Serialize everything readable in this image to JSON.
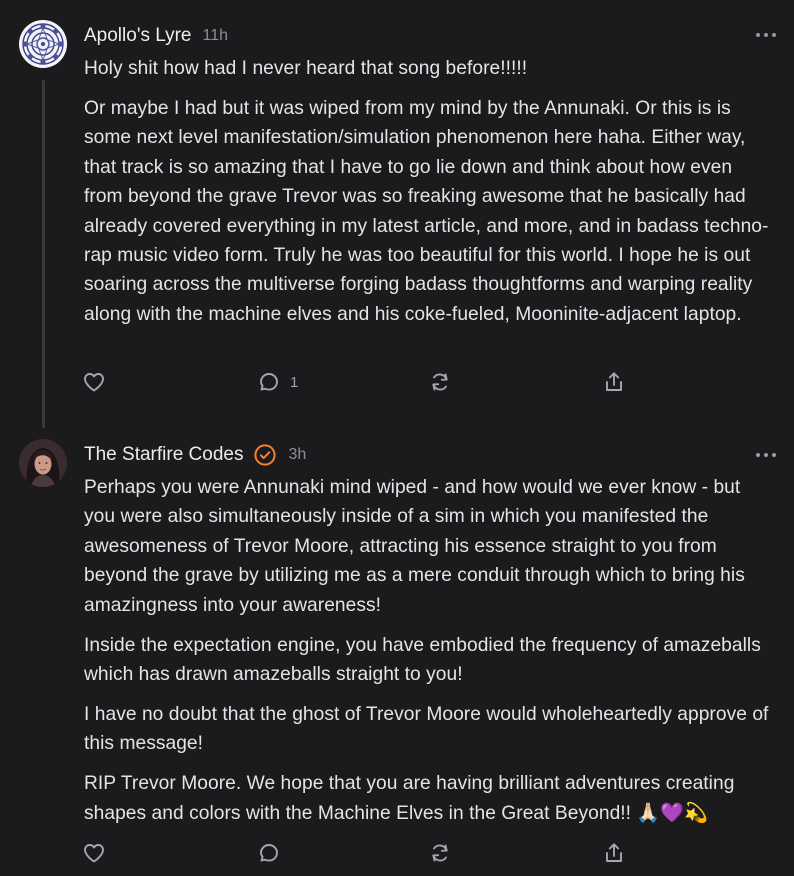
{
  "comments": [
    {
      "author": "Apollo's Lyre",
      "time": "11h",
      "avatar": "mandala-avatar",
      "paragraphs": [
        "Holy shit how had I never heard that song before!!!!!",
        "Or maybe I had but it was wiped from my mind by the Annunaki. Or this is is some next level manifestation/simulation phenomenon here haha. Either way, that track is so amazing that I have to go lie down and think about how even from beyond the grave Trevor was so freaking awesome that he basically had already covered everything in my latest article, and more, and in badass techno-rap music video form. Truly he was too beautiful for this world. I hope he is out soaring across the multiverse forging badass thoughtforms and warping reality along with the machine elves and his coke-fueled, Mooninite-adjacent laptop."
      ],
      "actions": {
        "like_icon": "heart-icon",
        "reply_icon": "comment-icon",
        "reply_count": "1",
        "restack_icon": "restack-icon",
        "share_icon": "share-icon"
      }
    },
    {
      "author": "The Starfire Codes",
      "verified_icon": "verified-check-icon",
      "time": "3h",
      "avatar": "profile-photo-avatar",
      "paragraphs": [
        "Perhaps you were Annunaki mind wiped - and how would we ever know - but you were also simultaneously inside of a sim in which you manifested the awesomeness of Trevor Moore, attracting his essence straight to you from beyond the grave by utilizing me as a mere conduit through which to bring his amazingness into your awareness!",
        "Inside the expectation engine, you have embodied the frequency of amazeballs which has drawn amazeballs straight to you!",
        "I have no doubt that the ghost of Trevor Moore would wholeheartedly approve of this message!",
        "RIP Trevor Moore. We hope that you are having brilliant adventures creating shapes and colors with the Machine Elves in the Great Beyond!! 🙏🏻💜💫"
      ],
      "actions": {
        "like_icon": "heart-icon",
        "reply_icon": "comment-icon",
        "restack_icon": "restack-icon",
        "share_icon": "share-icon"
      }
    }
  ],
  "colors": {
    "background": "#1b1b1d",
    "text": "#e4e4e7",
    "muted": "#8e8e93",
    "thread_line": "#3a3a3d",
    "verified": "#f5812b"
  }
}
